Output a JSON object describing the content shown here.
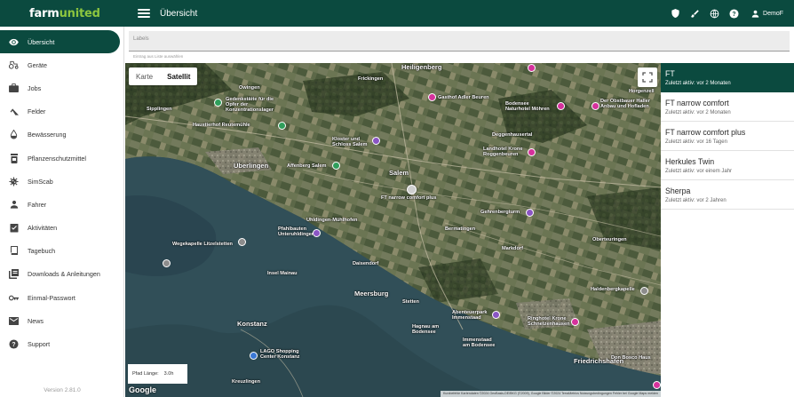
{
  "app": {
    "logo": "farm",
    "logo_accent": "united",
    "page_title": "Übersicht",
    "user_name": "DemoF",
    "version": "Version 2.81.0"
  },
  "header_icons": [
    "shield-icon",
    "brush-icon",
    "globe-icon",
    "help-icon",
    "person-icon"
  ],
  "sidebar": {
    "items": [
      {
        "label": "Übersicht",
        "icon": "eye-icon",
        "active": true
      },
      {
        "label": "Geräte",
        "icon": "tractor-icon"
      },
      {
        "label": "Jobs",
        "icon": "briefcase-icon"
      },
      {
        "label": "Felder",
        "icon": "terrain-icon"
      },
      {
        "label": "Bewässerung",
        "icon": "water-drop-icon"
      },
      {
        "label": "Pflanzenschutzmittel",
        "icon": "pesticide-icon"
      },
      {
        "label": "SimScab",
        "icon": "virus-icon"
      },
      {
        "label": "Fahrer",
        "icon": "person-icon"
      },
      {
        "label": "Aktivitäten",
        "icon": "checklist-icon"
      },
      {
        "label": "Tagebuch",
        "icon": "book-icon"
      },
      {
        "label": "Downloads & Anleitungen",
        "icon": "library-icon"
      },
      {
        "label": "Einmal-Passwort",
        "icon": "key-icon"
      },
      {
        "label": "News",
        "icon": "mail-icon"
      },
      {
        "label": "Support",
        "icon": "help-icon"
      }
    ]
  },
  "labels": {
    "placeholder": "Labels",
    "hint": "Eintrag aus Liste auswählen"
  },
  "map": {
    "type_options": [
      "Karte",
      "Satellit"
    ],
    "selected_type": "Satellit",
    "path_length_label": "Pfad Länge:",
    "path_length_value": "3.0h",
    "google": "Google",
    "attribution": "Kurzbefehle   Kartendaten ©2024 GeoBasis-DE/BKG (©2009), Google Bilder ©2024 TerraMetrics   Nutzungsbedingungen   Fehler bei Google Maps melden",
    "places": [
      {
        "text": "Heiligenberg",
        "big": true
      },
      {
        "text": "Owingen"
      },
      {
        "text": "Frickingen"
      },
      {
        "text": "Sipplingen"
      },
      {
        "text": "Gedenkstätte für die\nOpfer der\nKonzentrationslager"
      },
      {
        "text": "Gasthof Adler Beuren"
      },
      {
        "text": "Bodensee\nNaturhotel Möhren"
      },
      {
        "text": "Der Obstbauer Haller\nAnbau und Hofladen"
      },
      {
        "text": "Horgenzell"
      },
      {
        "text": "Haustierhof Reutemühle"
      },
      {
        "text": "Kloster und\nSchloss Salem"
      },
      {
        "text": "Deggenhausertal"
      },
      {
        "text": "Landhotel Krone\nRoggenbeuren"
      },
      {
        "text": "Affenberg Salem"
      },
      {
        "text": "Überlingen",
        "big": true
      },
      {
        "text": "Salem",
        "big": true
      },
      {
        "text": "FT narrow comfort plus"
      },
      {
        "text": "Gehrenbergturm"
      },
      {
        "text": "Pfahlbauten\nUnteruhldingen"
      },
      {
        "text": "Uhldingen-Mühlhofen"
      },
      {
        "text": "Wegekapelle Litzelstetten"
      },
      {
        "text": "Bermatingen"
      },
      {
        "text": "Markdorf"
      },
      {
        "text": "Oberteuringen"
      },
      {
        "text": "Daisendorf"
      },
      {
        "text": "Meersburg",
        "big": true
      },
      {
        "text": "Stetten"
      },
      {
        "text": "Haldenbergkapelle"
      },
      {
        "text": "Konstanz",
        "big": true
      },
      {
        "text": "Abenteuerpark\nImmenstaad"
      },
      {
        "text": "Ringhotel Krone\nSchnetzenhausen"
      },
      {
        "text": "Hagnau am\nBodensee"
      },
      {
        "text": "Immenstaad\nam Bodensee"
      },
      {
        "text": "LAGO Shopping\nCenter Konstanz"
      },
      {
        "text": "Friedrichshafen",
        "big": true
      },
      {
        "text": "Don Bosco Haus"
      },
      {
        "text": "Kreuzlingen"
      },
      {
        "text": "Insel Mainau"
      }
    ]
  },
  "devices": [
    {
      "name": "FT",
      "status": "Zuletzt aktiv: vor 2 Monaten",
      "active": true
    },
    {
      "name": "FT narrow comfort",
      "status": "Zuletzt aktiv: vor 2 Monaten"
    },
    {
      "name": "FT narrow comfort plus",
      "status": "Zuletzt aktiv: vor 16 Tagen"
    },
    {
      "name": "Herkules Twin",
      "status": "Zuletzt aktiv: vor einem Jahr"
    },
    {
      "name": "Sherpa",
      "status": "Zuletzt aktiv: vor 2 Jahren"
    }
  ],
  "colors": {
    "primary": "#0b4a3f",
    "logo_accent": "#8dc63f",
    "lake": "#2c4850"
  }
}
